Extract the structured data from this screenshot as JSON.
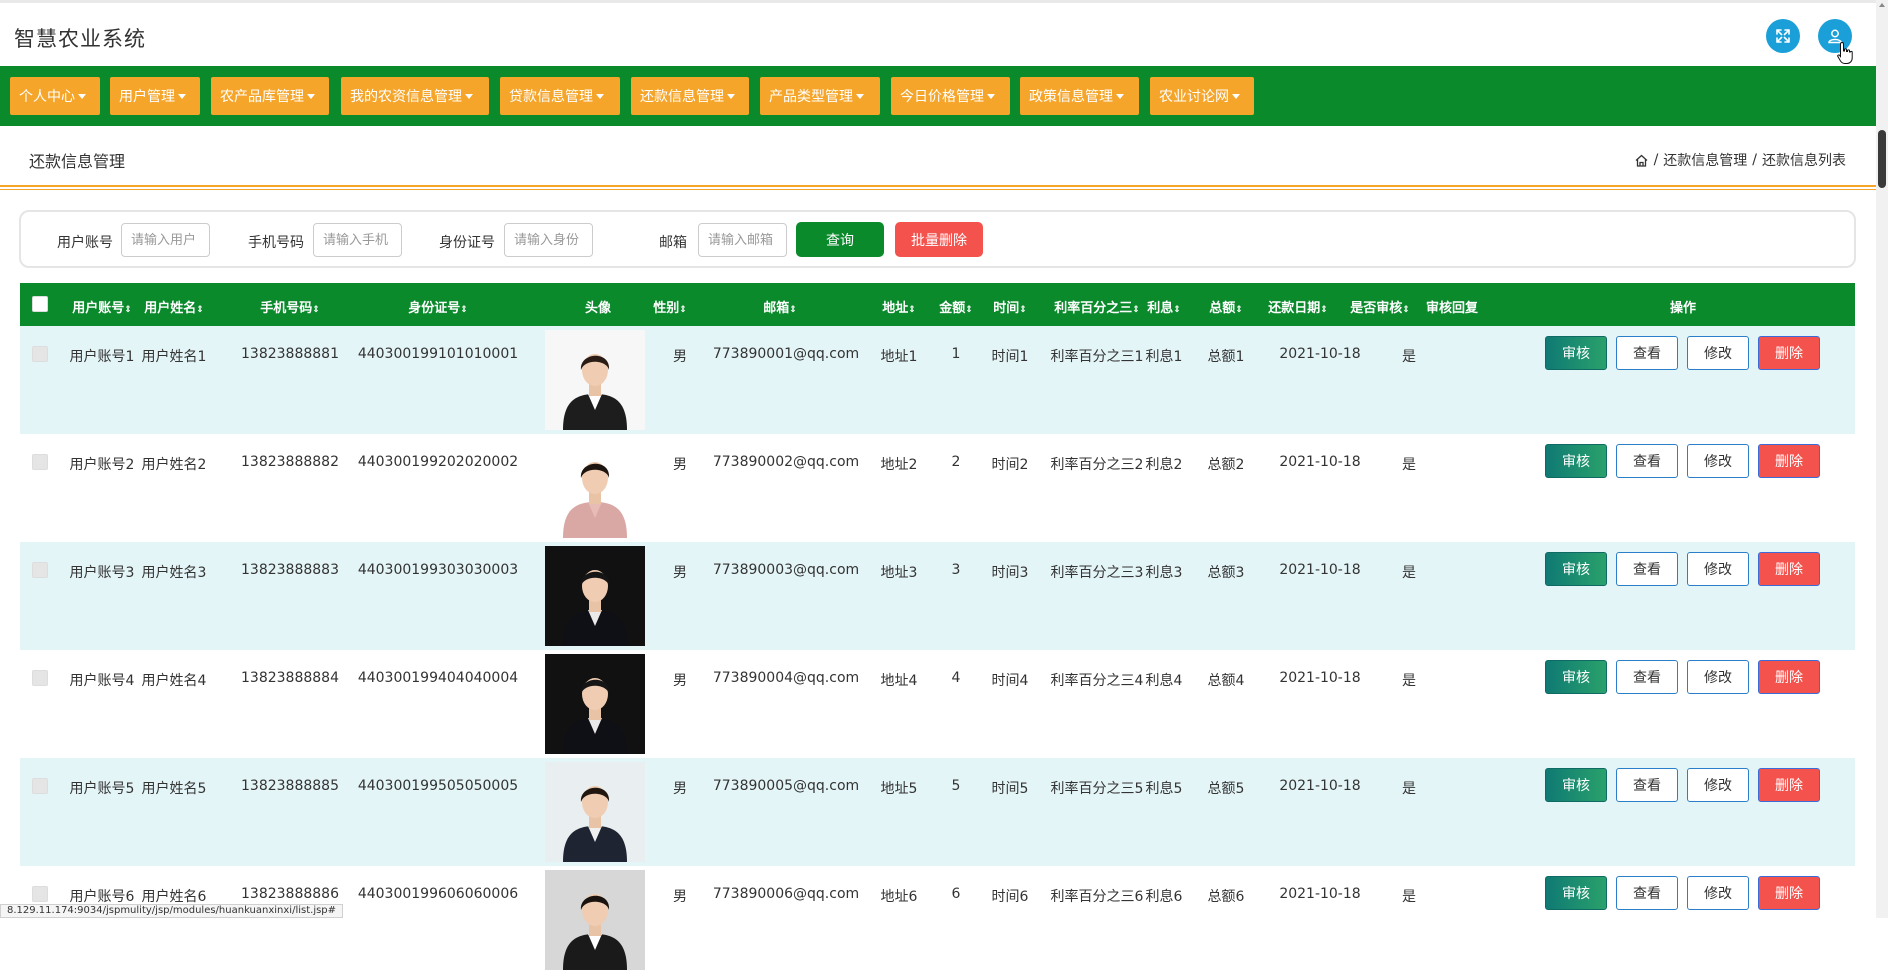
{
  "app": {
    "title": "智慧农业系统"
  },
  "topbar": {
    "fullscreen_icon": "expand-icon",
    "user_icon": "user-icon"
  },
  "nav": [
    "个人中心",
    "用户管理",
    "农产品库管理",
    "我的农资信息管理",
    "贷款信息管理",
    "还款信息管理",
    "产品类型管理",
    "今日价格管理",
    "政策信息管理",
    "农业讨论网"
  ],
  "page": {
    "title": "还款信息管理",
    "breadcrumb": [
      "还款信息管理",
      "还款信息列表"
    ],
    "breadcrumb_sep": "/"
  },
  "search": {
    "fields": [
      {
        "label": "用户账号",
        "placeholder": "请输入用户"
      },
      {
        "label": "手机号码",
        "placeholder": "请输入手机"
      },
      {
        "label": "身份证号",
        "placeholder": "请输入身份"
      },
      {
        "label": "邮箱",
        "placeholder": "请输入邮箱"
      }
    ],
    "query_label": "查询",
    "bulk_delete_label": "批量删除"
  },
  "table": {
    "columns": [
      {
        "label": "用户账号",
        "sortable": true
      },
      {
        "label": "用户姓名",
        "sortable": true
      },
      {
        "label": "手机号码",
        "sortable": true
      },
      {
        "label": "身份证号",
        "sortable": true
      },
      {
        "label": "头像",
        "sortable": false
      },
      {
        "label": "性别",
        "sortable": true
      },
      {
        "label": "邮箱",
        "sortable": true
      },
      {
        "label": "地址",
        "sortable": true
      },
      {
        "label": "金额",
        "sortable": true
      },
      {
        "label": "时间",
        "sortable": true
      },
      {
        "label": "利率百分之三",
        "sortable": true
      },
      {
        "label": "利息",
        "sortable": true
      },
      {
        "label": "总额",
        "sortable": true
      },
      {
        "label": "还款日期",
        "sortable": true
      },
      {
        "label": "是否审核",
        "sortable": true
      },
      {
        "label": "审核回复",
        "sortable": false
      },
      {
        "label": "操作",
        "sortable": false
      }
    ],
    "sort_glyph": "⇕",
    "actions": {
      "review": "审核",
      "view": "查看",
      "edit": "修改",
      "delete": "删除"
    },
    "rows": [
      {
        "account": "用户账号1",
        "name": "用户姓名1",
        "phone": "13823888881",
        "id_card": "440300199101010001",
        "gender": "男",
        "email": "773890001@qq.com",
        "address": "地址1",
        "amount": "1",
        "time": "时间1",
        "rate": "利率百分之三1",
        "interest": "利息1",
        "total": "总额1",
        "repay_date": "2021-10-18",
        "reviewed": "是",
        "reply": ""
      },
      {
        "account": "用户账号2",
        "name": "用户姓名2",
        "phone": "13823888882",
        "id_card": "440300199202020002",
        "gender": "男",
        "email": "773890002@qq.com",
        "address": "地址2",
        "amount": "2",
        "time": "时间2",
        "rate": "利率百分之三2",
        "interest": "利息2",
        "total": "总额2",
        "repay_date": "2021-10-18",
        "reviewed": "是",
        "reply": ""
      },
      {
        "account": "用户账号3",
        "name": "用户姓名3",
        "phone": "13823888883",
        "id_card": "440300199303030003",
        "gender": "男",
        "email": "773890003@qq.com",
        "address": "地址3",
        "amount": "3",
        "time": "时间3",
        "rate": "利率百分之三3",
        "interest": "利息3",
        "total": "总额3",
        "repay_date": "2021-10-18",
        "reviewed": "是",
        "reply": ""
      },
      {
        "account": "用户账号4",
        "name": "用户姓名4",
        "phone": "13823888884",
        "id_card": "440300199404040004",
        "gender": "男",
        "email": "773890004@qq.com",
        "address": "地址4",
        "amount": "4",
        "time": "时间4",
        "rate": "利率百分之三4",
        "interest": "利息4",
        "total": "总额4",
        "repay_date": "2021-10-18",
        "reviewed": "是",
        "reply": ""
      },
      {
        "account": "用户账号5",
        "name": "用户姓名5",
        "phone": "13823888885",
        "id_card": "440300199505050005",
        "gender": "男",
        "email": "773890005@qq.com",
        "address": "地址5",
        "amount": "5",
        "time": "时间5",
        "rate": "利率百分之三5",
        "interest": "利息5",
        "total": "总额5",
        "repay_date": "2021-10-18",
        "reviewed": "是",
        "reply": ""
      },
      {
        "account": "用户账号6",
        "name": "用户姓名6",
        "phone": "13823888886",
        "id_card": "440300199606060006",
        "gender": "男",
        "email": "773890006@qq.com",
        "address": "地址6",
        "amount": "6",
        "time": "时间6",
        "rate": "利率百分之三6",
        "interest": "利息6",
        "total": "总额6",
        "repay_date": "2021-10-18",
        "reviewed": "是",
        "reply": ""
      }
    ]
  },
  "status_bar": {
    "url": "8.129.11.174:9034/jspmulity/jsp/modules/huankuanxinxi/list.jsp#"
  },
  "colors": {
    "nav_bg": "#0b8a2c",
    "nav_item": "#f5a52a",
    "accent_blue": "#1a9fd8",
    "danger": "#f4524d",
    "row_alt": "#e4f5f8"
  }
}
